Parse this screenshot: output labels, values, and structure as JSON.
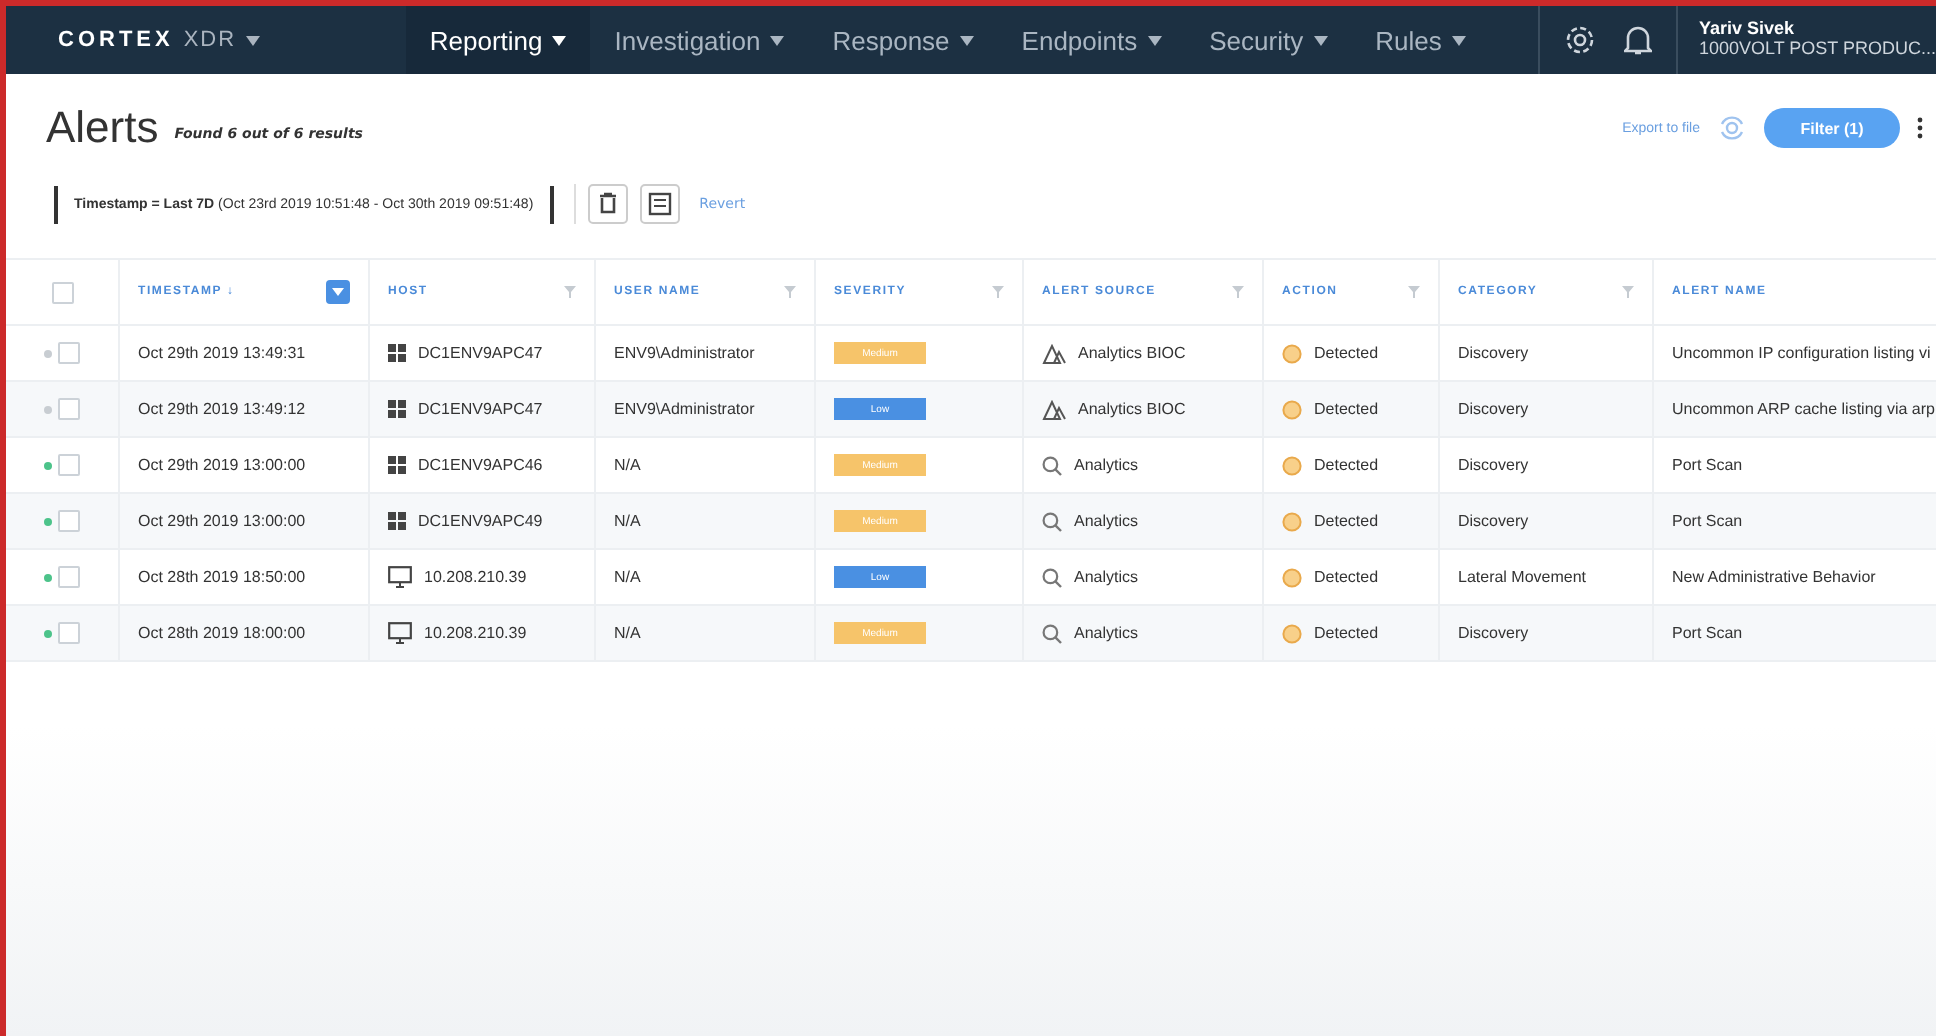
{
  "nav": {
    "logo": "CORTEX",
    "product": "XDR",
    "menus": [
      {
        "label": "Reporting",
        "selected": true
      },
      {
        "label": "Investigation",
        "selected": false
      },
      {
        "label": "Response",
        "selected": false
      },
      {
        "label": "Endpoints",
        "selected": false
      },
      {
        "label": "Security",
        "selected": false
      },
      {
        "label": "Rules",
        "selected": false
      }
    ],
    "user": {
      "name": "Yariv Sivek",
      "org": "1000VOLT POST PRODUC..."
    }
  },
  "page": {
    "title": "Alerts",
    "result_count": "Found 6 out of 6 results",
    "export": "Export to file",
    "filter_button": "Filter (1)"
  },
  "filter": {
    "text": "**Timestamp = Last 7D** (Oct 23rd 2019 10:51:48 - Oct 30th 2019 09:51:48)",
    "revert": "Revert"
  },
  "table": {
    "select_all": {
      "checked": false
    },
    "columns": [
      "TIMESTAMP ↓",
      "HOST",
      "USER NAME",
      "SEVERITY",
      "ALERT SOURCE",
      "ACTION",
      "CATEGORY",
      "ALERT NAME"
    ],
    "rows": [
      {
        "checked": false,
        "color": "#c8cdd2",
        "timestamp": "Oct 29th 2019 13:49:31",
        "host": {
          "kind": "windows",
          "text": "DC1ENV9APC47"
        },
        "user": "ENV9\\Administrator",
        "severity": {
          "kind": "medium",
          "text": "Medium"
        },
        "source": {
          "kind": "bioc",
          "text": "Analytics BIOC"
        },
        "action": "Detected",
        "category": "Discovery",
        "alert_name": "Uncommon IP configuration listing vi"
      },
      {
        "checked": false,
        "color": "#c8cdd2",
        "timestamp": "Oct 29th 2019 13:49:12",
        "host": {
          "kind": "windows",
          "text": "DC1ENV9APC47"
        },
        "user": "ENV9\\Administrator",
        "severity": {
          "kind": "low",
          "text": "Low"
        },
        "source": {
          "kind": "bioc",
          "text": "Analytics BIOC"
        },
        "action": "Detected",
        "category": "Discovery",
        "alert_name": "Uncommon ARP cache listing via arp"
      },
      {
        "checked": false,
        "color": "#4cc38a",
        "timestamp": "Oct 29th 2019 13:00:00",
        "host": {
          "kind": "windows",
          "text": "DC1ENV9APC46"
        },
        "user": "N/A",
        "severity": {
          "kind": "medium",
          "text": "Medium"
        },
        "source": {
          "kind": "analytics",
          "text": "Analytics"
        },
        "action": "Detected",
        "category": "Discovery",
        "alert_name": "Port Scan"
      },
      {
        "checked": false,
        "color": "#4cc38a",
        "timestamp": "Oct 29th 2019 13:00:00",
        "host": {
          "kind": "windows",
          "text": "DC1ENV9APC49"
        },
        "user": "N/A",
        "severity": {
          "kind": "medium",
          "text": "Medium"
        },
        "source": {
          "kind": "analytics",
          "text": "Analytics"
        },
        "action": "Detected",
        "category": "Discovery",
        "alert_name": "Port Scan"
      },
      {
        "checked": false,
        "color": "#4cc38a",
        "timestamp": "Oct 28th 2019 18:50:00",
        "host": {
          "kind": "monitor",
          "text": "10.208.210.39"
        },
        "user": "N/A",
        "severity": {
          "kind": "low",
          "text": "Low"
        },
        "source": {
          "kind": "analytics",
          "text": "Analytics"
        },
        "action": "Detected",
        "category": "Lateral Movement",
        "alert_name": "New Administrative Behavior"
      },
      {
        "checked": false,
        "color": "#4cc38a",
        "timestamp": "Oct 28th 2019 18:00:00",
        "host": {
          "kind": "monitor",
          "text": "10.208.210.39"
        },
        "user": "N/A",
        "severity": {
          "kind": "medium",
          "text": "Medium"
        },
        "source": {
          "kind": "analytics",
          "text": "Analytics"
        },
        "action": "Detected",
        "category": "Discovery",
        "alert_name": "Port Scan"
      }
    ]
  }
}
